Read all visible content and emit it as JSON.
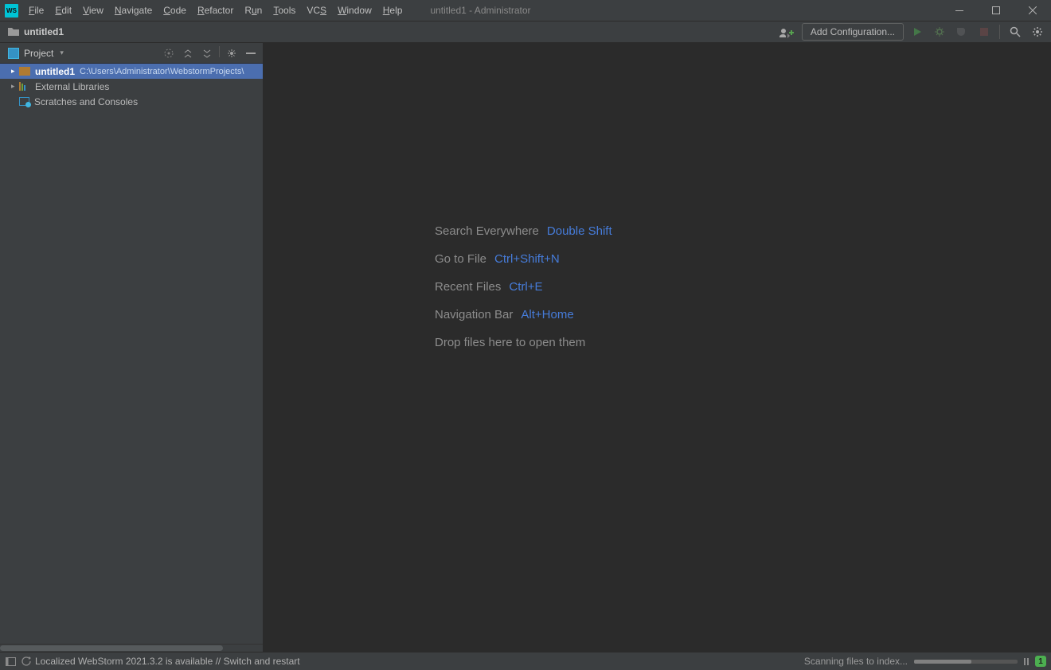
{
  "window": {
    "title": "untitled1 - Administrator"
  },
  "menu": {
    "items": [
      "File",
      "Edit",
      "View",
      "Navigate",
      "Code",
      "Refactor",
      "Run",
      "Tools",
      "VCS",
      "Window",
      "Help"
    ]
  },
  "breadcrumb": {
    "project": "untitled1"
  },
  "toolbar": {
    "add_configuration": "Add Configuration..."
  },
  "project_tool": {
    "title": "Project"
  },
  "tree": {
    "root": {
      "name": "untitled1",
      "path": "C:\\Users\\Administrator\\WebstormProjects\\"
    },
    "external": "External Libraries",
    "scratches": "Scratches and Consoles"
  },
  "editor_hints": [
    {
      "label": "Search Everywhere",
      "shortcut": "Double Shift"
    },
    {
      "label": "Go to File",
      "shortcut": "Ctrl+Shift+N"
    },
    {
      "label": "Recent Files",
      "shortcut": "Ctrl+E"
    },
    {
      "label": "Navigation Bar",
      "shortcut": "Alt+Home"
    },
    {
      "label": "Drop files here to open them",
      "shortcut": ""
    }
  ],
  "status": {
    "message": "Localized WebStorm 2021.3.2 is available // Switch and restart",
    "task": "Scanning files to index...",
    "badge": "1"
  }
}
